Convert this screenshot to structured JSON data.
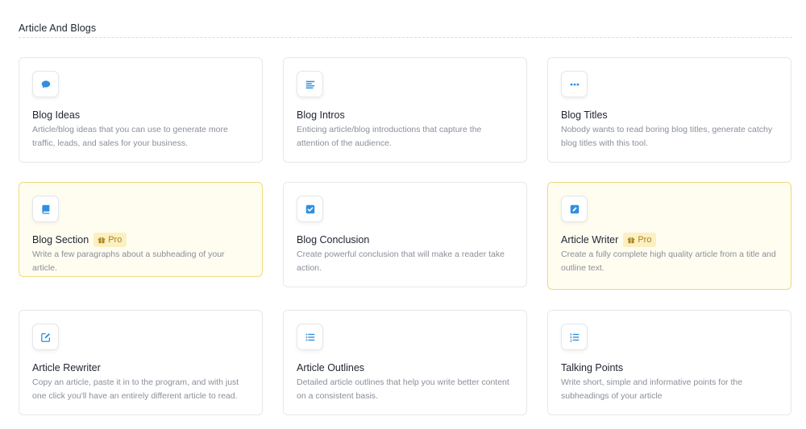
{
  "section": {
    "title": "Article And Blogs"
  },
  "colors": {
    "accent": "#2f8fe0",
    "pro_bg": "#fffdf0",
    "pro_border": "#f2d97a",
    "badge_bg": "#fbf0c2",
    "badge_text": "#b0821a"
  },
  "cards": [
    {
      "title": "Blog Ideas",
      "icon": "chat-bubble-icon",
      "pro": false,
      "description": "Article/blog ideas that you can use to generate more traffic, leads, and sales for your business."
    },
    {
      "title": "Blog Intros",
      "icon": "align-left-icon",
      "pro": false,
      "description": "Enticing article/blog introductions that capture the attention of the audience."
    },
    {
      "title": "Blog Titles",
      "icon": "ellipsis-icon",
      "pro": false,
      "description": "Nobody wants to read boring blog titles, generate catchy blog titles with this tool."
    },
    {
      "title": "Blog Section",
      "icon": "book-icon",
      "pro": true,
      "badge": "Pro",
      "description": "Write a few paragraphs about a subheading of your article."
    },
    {
      "title": "Blog Conclusion",
      "icon": "check-square-icon",
      "pro": false,
      "description": "Create powerful conclusion that will make a reader take action."
    },
    {
      "title": "Article Writer",
      "icon": "pen-square-icon",
      "pro": true,
      "badge": "Pro",
      "description": "Create a fully complete high quality article from a title and outline text."
    },
    {
      "title": "Article Rewriter",
      "icon": "edit-icon",
      "pro": false,
      "description": "Copy an article, paste it in to the program, and with just one click you'll have an entirely different article to read."
    },
    {
      "title": "Article Outlines",
      "icon": "list-icon",
      "pro": false,
      "description": "Detailed article outlines that help you write better content on a consistent basis."
    },
    {
      "title": "Talking Points",
      "icon": "ordered-list-icon",
      "pro": false,
      "description": "Write short, simple and informative points for the subheadings of your article"
    }
  ]
}
